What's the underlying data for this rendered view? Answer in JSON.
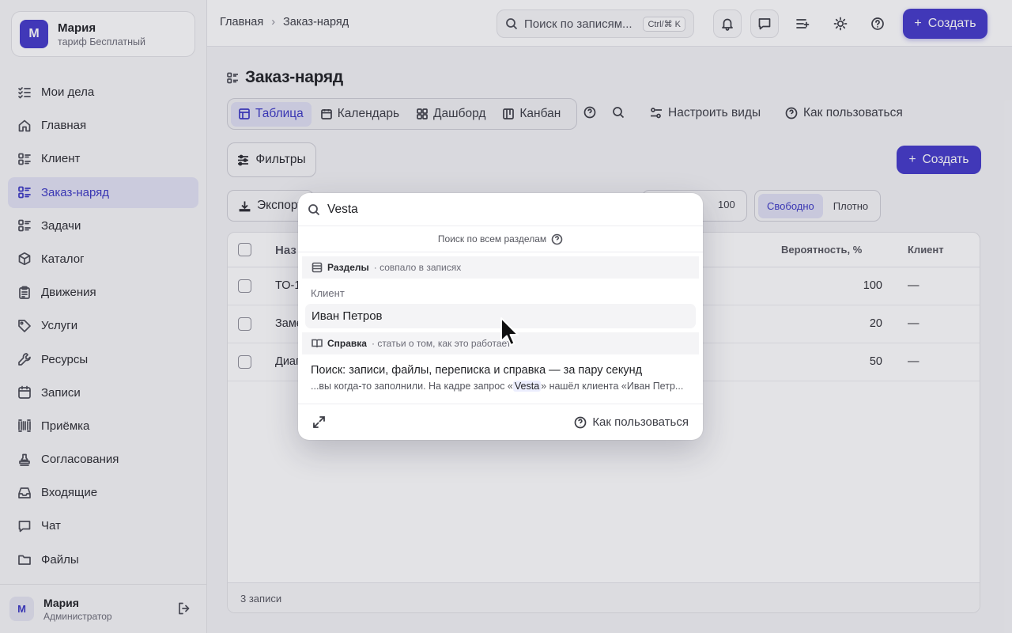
{
  "account": {
    "initial": "М",
    "name": "Мария",
    "plan": "тариф Бесплатный"
  },
  "sidebar": {
    "items": [
      {
        "label": "Мои дела",
        "icon": "checklist-icon"
      },
      {
        "label": "Главная",
        "icon": "home-icon"
      },
      {
        "label": "Клиент",
        "icon": "list-icon"
      },
      {
        "label": "Заказ-наряд",
        "icon": "list-icon",
        "active": true
      },
      {
        "label": "Задачи",
        "icon": "list-icon"
      },
      {
        "label": "Каталог",
        "icon": "box-icon"
      },
      {
        "label": "Движения",
        "icon": "clipboard-icon"
      },
      {
        "label": "Услуги",
        "icon": "tag-icon"
      },
      {
        "label": "Ресурсы",
        "icon": "wrench-icon"
      },
      {
        "label": "Записи",
        "icon": "calendar-icon"
      },
      {
        "label": "Приёмка",
        "icon": "barcode-icon"
      },
      {
        "label": "Согласования",
        "icon": "stamp-icon"
      },
      {
        "label": "Входящие",
        "icon": "inbox-icon"
      },
      {
        "label": "Чат",
        "icon": "chat-icon"
      },
      {
        "label": "Файлы",
        "icon": "folder-icon"
      }
    ]
  },
  "user": {
    "initial": "М",
    "name": "Мария",
    "role": "Администратор"
  },
  "topbar": {
    "breadcrumb": [
      "Главная",
      "Заказ-наряд"
    ],
    "search_placeholder": "Поиск по записям...",
    "shortcut": "Ctrl/⌘ K",
    "create_label": "Создать"
  },
  "page": {
    "title": "Заказ-наряд",
    "tabs": [
      "Таблица",
      "Календарь",
      "Дашборд",
      "Канбан"
    ],
    "configure_views": "Настроить виды",
    "how_to_use": "Как пользоваться",
    "filters": "Фильтры",
    "create": "Создать",
    "export": "Экспорт",
    "page_size": "100",
    "density": [
      "Свободно",
      "Плотно"
    ]
  },
  "table": {
    "columns": [
      "Наз",
      "Вероятность, %",
      "Клиент"
    ],
    "rows": [
      {
        "name": "ТО-1",
        "probability": "100",
        "client": "—"
      },
      {
        "name": "Заме",
        "probability": "20",
        "client": "—"
      },
      {
        "name": "Диаг",
        "probability": "50",
        "client": "—"
      }
    ],
    "footer": "3 записи"
  },
  "search_modal": {
    "query": "Vesta",
    "scope": "Поиск по всем разделам",
    "sections_title": "Разделы",
    "sections_sub": "· совпало в записях",
    "group_label": "Клиент",
    "result": "Иван Петров",
    "help_title": "Справка",
    "help_sub": "· статьи о том, как это работает",
    "help_article": "Поиск: записи, файлы, переписка и справка — за пару секунд",
    "snippet_pre": "...вы когда-то заполнили. На кадре запрос «",
    "snippet_hl": "Vesta",
    "snippet_post": "» нашёл клиента «Иван Петр...",
    "how_to_use": "Как пользоваться"
  },
  "colors": {
    "accent": "#4338ca",
    "active_bg": "#e4e4f5"
  }
}
